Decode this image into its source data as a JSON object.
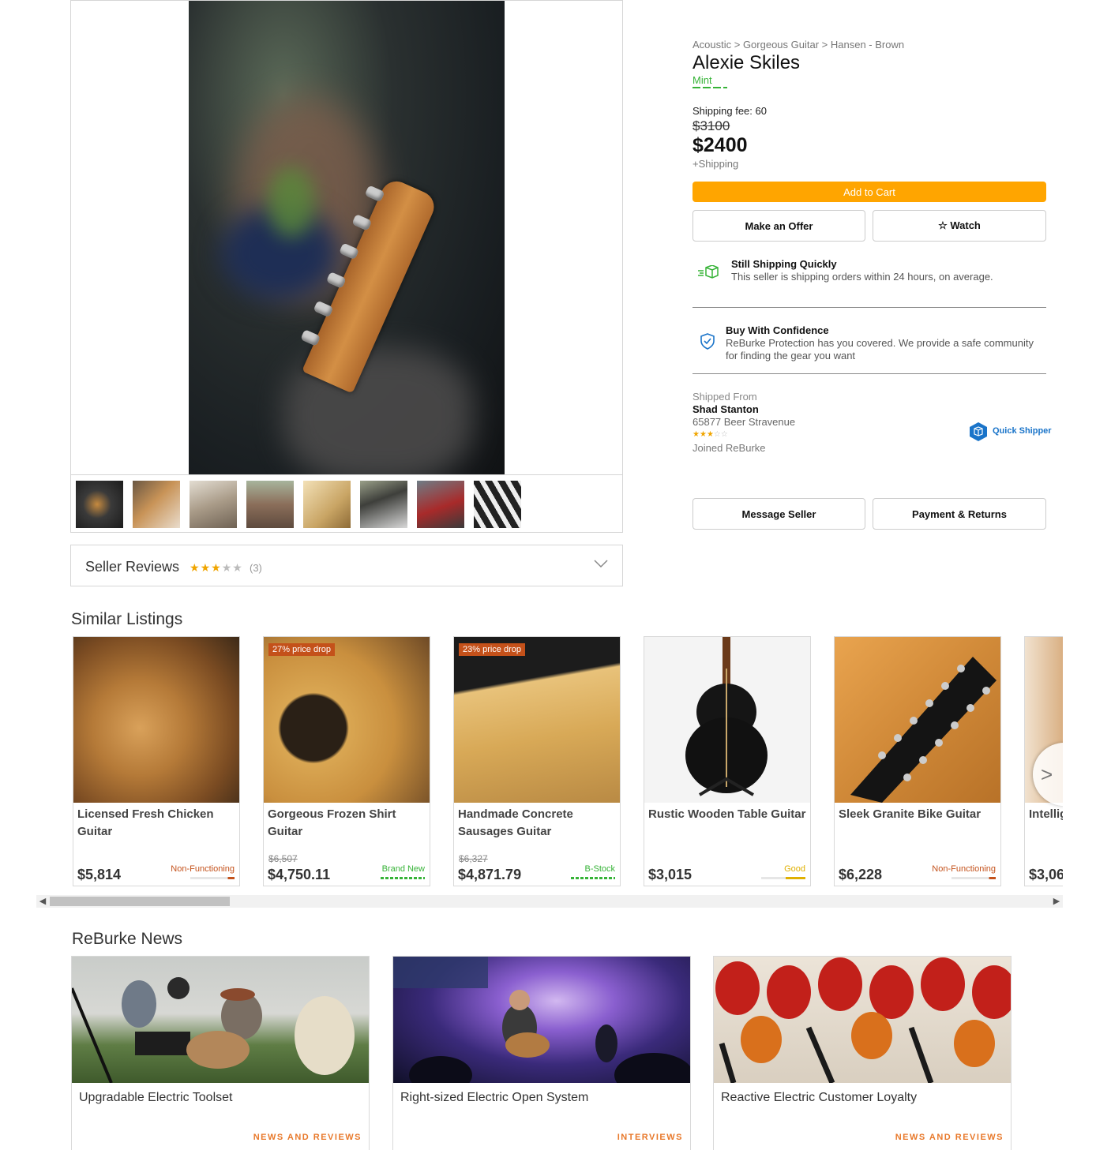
{
  "product": {
    "breadcrumb": "Acoustic > Gorgeous Guitar > Hansen - Brown",
    "title": "Alexie Skiles",
    "condition": "Mint",
    "shipping_fee": "Shipping fee: 60",
    "original_price": "$3100",
    "price": "$2400",
    "plus_shipping": "+Shipping"
  },
  "actions": {
    "add_to_cart": "Add to Cart",
    "make_offer": "Make an Offer",
    "watch": "☆ Watch",
    "message_seller": "Message Seller",
    "payment_returns": "Payment & Returns"
  },
  "shipping_quickly": {
    "title": "Still Shipping Quickly",
    "text": "This seller is shipping orders within 24 hours, on average."
  },
  "confidence": {
    "title": "Buy With Confidence",
    "text": "ReBurke Protection has you covered. We provide a safe community for finding the gear you want"
  },
  "seller": {
    "shipped_from_label": "Shipped From",
    "name": "Shad Stanton",
    "address": "65877 Beer Stravenue",
    "rating": 3,
    "joined": "Joined ReBurke",
    "badge": "Quick Shipper"
  },
  "seller_reviews": {
    "title": "Seller Reviews",
    "rating": 3,
    "count": "(3)"
  },
  "similar": {
    "title": "Similar Listings",
    "items": [
      {
        "name": "Licensed Fresh Chicken Guitar",
        "price": "$5,814",
        "was": "",
        "badge": "",
        "condition": "Non-Functioning",
        "condition_color": "#c4511a",
        "level": 0.15
      },
      {
        "name": "Gorgeous Frozen Shirt Guitar",
        "price": "$4,750.11",
        "was": "$6,507",
        "badge": "27% price drop",
        "condition": "Brand New",
        "condition_color": "#36b337",
        "level": 1.0
      },
      {
        "name": "Handmade Concrete Sausages Guitar",
        "price": "$4,871.79",
        "was": "$6,327",
        "badge": "23% price drop",
        "condition": "B-Stock",
        "condition_color": "#36b337",
        "level": 1.0
      },
      {
        "name": "Rustic Wooden Table Guitar",
        "price": "$3,015",
        "was": "",
        "badge": "",
        "condition": "Good",
        "condition_color": "#e0b000",
        "level": 0.45
      },
      {
        "name": "Sleek Granite Bike Guitar",
        "price": "$6,228",
        "was": "",
        "badge": "",
        "condition": "Non-Functioning",
        "condition_color": "#c4511a",
        "level": 0.15
      },
      {
        "name": "Intelligent Guitar",
        "price": "$3,06",
        "was": "",
        "badge": "",
        "condition": "",
        "condition_color": "#c4511a",
        "level": 0
      }
    ]
  },
  "news": {
    "title": "ReBurke News",
    "items": [
      {
        "title": "Upgradable Electric Toolset",
        "category": "NEWS AND REVIEWS"
      },
      {
        "title": "Right-sized Electric Open System",
        "category": "INTERVIEWS"
      },
      {
        "title": "Reactive Electric Customer Loyalty",
        "category": "NEWS AND REVIEWS"
      }
    ]
  },
  "colors": {
    "accent": "#ffa500",
    "condition_good": "#36b337",
    "news_category": "#e8792b",
    "badge": "#c4511a"
  }
}
